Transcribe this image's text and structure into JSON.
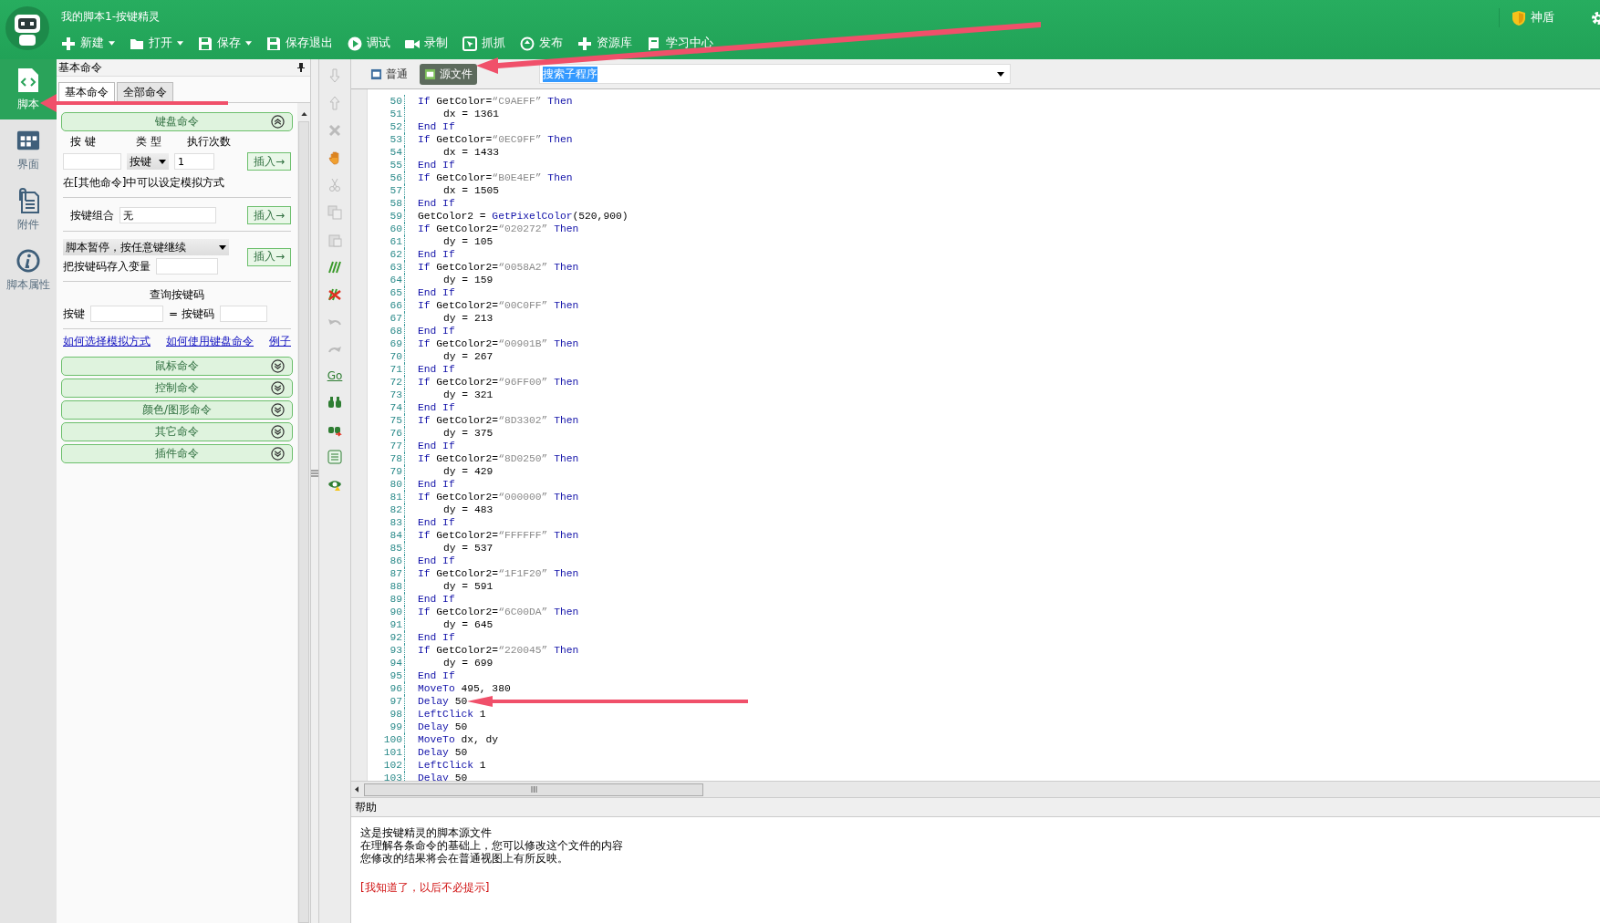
{
  "window": {
    "title": "我的脚本1-按键精灵"
  },
  "toolbar": [
    {
      "label": "新建",
      "dropdown": true
    },
    {
      "label": "打开",
      "dropdown": true
    },
    {
      "label": "保存",
      "dropdown": true
    },
    {
      "label": "保存退出",
      "dropdown": false
    },
    {
      "label": "调试",
      "dropdown": false
    },
    {
      "label": "录制",
      "dropdown": false
    },
    {
      "label": "抓抓",
      "dropdown": false
    },
    {
      "label": "发布",
      "dropdown": false
    },
    {
      "label": "资源库",
      "dropdown": false
    },
    {
      "label": "学习中心",
      "dropdown": false
    }
  ],
  "shield": {
    "label": "神盾"
  },
  "sidebar": [
    {
      "label": "脚本",
      "selected": true
    },
    {
      "label": "界面",
      "selected": false
    },
    {
      "label": "附件",
      "selected": false
    },
    {
      "label": "脚本属性",
      "selected": false
    }
  ],
  "command_panel": {
    "title": "基本命令",
    "tabs": [
      {
        "label": "基本命令",
        "selected": true
      },
      {
        "label": "全部命令",
        "selected": false
      }
    ],
    "keyboard": {
      "title": "键盘命令",
      "expanded": true,
      "key_label": "按 键",
      "type_label": "类 型",
      "count_label": "执行次数",
      "type_value": "按键",
      "count_value": "1",
      "note": "在[其他命令]中可以设定模拟方式",
      "combo_label": "按键组合",
      "combo_value": "无",
      "pause_value": "脚本暂停，按任意键继续",
      "store_label": "把按键码存入变量",
      "query_title": "查询按键码",
      "query_key_label": "按键",
      "query_code_label": "= 按键码",
      "inserts": [
        "插入→",
        "插入→",
        "插入→"
      ],
      "links": [
        "如何选择模拟方式",
        "如何使用键盘命令",
        "例子"
      ]
    },
    "sections": [
      {
        "title": "鼠标命令",
        "expanded": false
      },
      {
        "title": "控制命令",
        "expanded": false
      },
      {
        "title": "颜色/图形命令",
        "expanded": false
      },
      {
        "title": "其它命令",
        "expanded": false
      },
      {
        "title": "插件命令",
        "expanded": false
      }
    ]
  },
  "tool_strip": {
    "go_label": "Go"
  },
  "editor": {
    "tabs": [
      {
        "label": "普通",
        "selected": false
      },
      {
        "label": "源文件",
        "selected": true
      }
    ],
    "search": {
      "value": "搜索子程序"
    },
    "lines": [
      {
        "n": "50",
        "segs": [
          {
            "kind": "kw",
            "t": "If"
          },
          {
            "kind": "txt",
            "t": " GetColor="
          },
          {
            "kind": "str",
            "t": "“C9AEFF”"
          },
          {
            "kind": "kw",
            "t": " Then"
          }
        ],
        "children": [
          {
            "n": "51",
            "segs": [
              {
                "kind": "txt",
                "t": "dx = 1361"
              }
            ]
          }
        ]
      },
      {
        "n": "52",
        "segs": [
          {
            "kind": "kw",
            "t": "End If"
          }
        ]
      },
      {
        "n": "53",
        "segs": [
          {
            "kind": "kw",
            "t": "If"
          },
          {
            "kind": "txt",
            "t": " GetColor="
          },
          {
            "kind": "str",
            "t": "“0EC9FF”"
          },
          {
            "kind": "kw",
            "t": " Then"
          }
        ],
        "children": [
          {
            "n": "54",
            "segs": [
              {
                "kind": "txt",
                "t": "dx = 1433"
              }
            ]
          }
        ]
      },
      {
        "n": "55",
        "segs": [
          {
            "kind": "kw",
            "t": "End If"
          }
        ]
      },
      {
        "n": "56",
        "segs": [
          {
            "kind": "kw",
            "t": "If"
          },
          {
            "kind": "txt",
            "t": " GetColor="
          },
          {
            "kind": "str",
            "t": "“B0E4EF”"
          },
          {
            "kind": "kw",
            "t": " Then"
          }
        ],
        "children": [
          {
            "n": "57",
            "segs": [
              {
                "kind": "txt",
                "t": "dx = 1505"
              }
            ]
          }
        ]
      },
      {
        "n": "58",
        "segs": [
          {
            "kind": "kw",
            "t": "End If"
          }
        ]
      },
      {
        "n": "59",
        "segs": [
          {
            "kind": "txt",
            "t": "GetColor2 = "
          },
          {
            "kind": "kw",
            "t": "GetPixelColor"
          },
          {
            "kind": "txt",
            "t": "(520,900)"
          }
        ]
      },
      {
        "n": "60",
        "segs": [
          {
            "kind": "kw",
            "t": "If"
          },
          {
            "kind": "txt",
            "t": " GetColor2="
          },
          {
            "kind": "str",
            "t": "“020272”"
          },
          {
            "kind": "kw",
            "t": " Then"
          }
        ],
        "children": [
          {
            "n": "61",
            "segs": [
              {
                "kind": "txt",
                "t": "dy = 105"
              }
            ]
          }
        ]
      },
      {
        "n": "62",
        "segs": [
          {
            "kind": "kw",
            "t": "End If"
          }
        ]
      },
      {
        "n": "63",
        "segs": [
          {
            "kind": "kw",
            "t": "If"
          },
          {
            "kind": "txt",
            "t": " GetColor2="
          },
          {
            "kind": "str",
            "t": "“0058A2”"
          },
          {
            "kind": "kw",
            "t": " Then"
          }
        ],
        "children": [
          {
            "n": "64",
            "segs": [
              {
                "kind": "txt",
                "t": "dy = 159"
              }
            ]
          }
        ]
      },
      {
        "n": "65",
        "segs": [
          {
            "kind": "kw",
            "t": "End If"
          }
        ]
      },
      {
        "n": "66",
        "segs": [
          {
            "kind": "kw",
            "t": "If"
          },
          {
            "kind": "txt",
            "t": " GetColor2="
          },
          {
            "kind": "str",
            "t": "“00C0FF”"
          },
          {
            "kind": "kw",
            "t": " Then"
          }
        ],
        "children": [
          {
            "n": "67",
            "segs": [
              {
                "kind": "txt",
                "t": "dy = 213"
              }
            ]
          }
        ]
      },
      {
        "n": "68",
        "segs": [
          {
            "kind": "kw",
            "t": "End If"
          }
        ]
      },
      {
        "n": "69",
        "segs": [
          {
            "kind": "kw",
            "t": "If"
          },
          {
            "kind": "txt",
            "t": " GetColor2="
          },
          {
            "kind": "str",
            "t": "“00901B”"
          },
          {
            "kind": "kw",
            "t": " Then"
          }
        ],
        "children": [
          {
            "n": "70",
            "segs": [
              {
                "kind": "txt",
                "t": "dy = 267"
              }
            ]
          }
        ]
      },
      {
        "n": "71",
        "segs": [
          {
            "kind": "kw",
            "t": "End If"
          }
        ]
      },
      {
        "n": "72",
        "segs": [
          {
            "kind": "kw",
            "t": "If"
          },
          {
            "kind": "txt",
            "t": " GetColor2="
          },
          {
            "kind": "str",
            "t": "“96FF00”"
          },
          {
            "kind": "kw",
            "t": " Then"
          }
        ],
        "children": [
          {
            "n": "73",
            "segs": [
              {
                "kind": "txt",
                "t": "dy = 321"
              }
            ]
          }
        ]
      },
      {
        "n": "74",
        "segs": [
          {
            "kind": "kw",
            "t": "End If"
          }
        ]
      },
      {
        "n": "75",
        "segs": [
          {
            "kind": "kw",
            "t": "If"
          },
          {
            "kind": "txt",
            "t": " GetColor2="
          },
          {
            "kind": "str",
            "t": "“8D3302”"
          },
          {
            "kind": "kw",
            "t": " Then"
          }
        ],
        "children": [
          {
            "n": "76",
            "segs": [
              {
                "kind": "txt",
                "t": "dy = 375"
              }
            ]
          }
        ]
      },
      {
        "n": "77",
        "segs": [
          {
            "kind": "kw",
            "t": "End If"
          }
        ]
      },
      {
        "n": "78",
        "segs": [
          {
            "kind": "kw",
            "t": "If"
          },
          {
            "kind": "txt",
            "t": " GetColor2="
          },
          {
            "kind": "str",
            "t": "“8D0250”"
          },
          {
            "kind": "kw",
            "t": " Then"
          }
        ],
        "children": [
          {
            "n": "79",
            "segs": [
              {
                "kind": "txt",
                "t": "dy = 429"
              }
            ]
          }
        ]
      },
      {
        "n": "80",
        "segs": [
          {
            "kind": "kw",
            "t": "End If"
          }
        ]
      },
      {
        "n": "81",
        "segs": [
          {
            "kind": "kw",
            "t": "If"
          },
          {
            "kind": "txt",
            "t": " GetColor2="
          },
          {
            "kind": "str",
            "t": "“000000”"
          },
          {
            "kind": "kw",
            "t": " Then"
          }
        ],
        "children": [
          {
            "n": "82",
            "segs": [
              {
                "kind": "txt",
                "t": "dy = 483"
              }
            ]
          }
        ]
      },
      {
        "n": "83",
        "segs": [
          {
            "kind": "kw",
            "t": "End If"
          }
        ]
      },
      {
        "n": "84",
        "segs": [
          {
            "kind": "kw",
            "t": "If"
          },
          {
            "kind": "txt",
            "t": " GetColor2="
          },
          {
            "kind": "str",
            "t": "“FFFFFF”"
          },
          {
            "kind": "kw",
            "t": " Then"
          }
        ],
        "children": [
          {
            "n": "85",
            "segs": [
              {
                "kind": "txt",
                "t": "dy = 537"
              }
            ]
          }
        ]
      },
      {
        "n": "86",
        "segs": [
          {
            "kind": "kw",
            "t": "End If"
          }
        ]
      },
      {
        "n": "87",
        "segs": [
          {
            "kind": "kw",
            "t": "If"
          },
          {
            "kind": "txt",
            "t": " GetColor2="
          },
          {
            "kind": "str",
            "t": "“1F1F20”"
          },
          {
            "kind": "kw",
            "t": " Then"
          }
        ],
        "children": [
          {
            "n": "88",
            "segs": [
              {
                "kind": "txt",
                "t": "dy = 591"
              }
            ]
          }
        ]
      },
      {
        "n": "89",
        "segs": [
          {
            "kind": "kw",
            "t": "End If"
          }
        ]
      },
      {
        "n": "90",
        "segs": [
          {
            "kind": "kw",
            "t": "If"
          },
          {
            "kind": "txt",
            "t": " GetColor2="
          },
          {
            "kind": "str",
            "t": "“6C00DA”"
          },
          {
            "kind": "kw",
            "t": " Then"
          }
        ],
        "children": [
          {
            "n": "91",
            "segs": [
              {
                "kind": "txt",
                "t": "dy = 645"
              }
            ]
          }
        ]
      },
      {
        "n": "92",
        "segs": [
          {
            "kind": "kw",
            "t": "End If"
          }
        ]
      },
      {
        "n": "93",
        "segs": [
          {
            "kind": "kw",
            "t": "If"
          },
          {
            "kind": "txt",
            "t": " GetColor2="
          },
          {
            "kind": "str",
            "t": "“220045”"
          },
          {
            "kind": "kw",
            "t": " Then"
          }
        ],
        "children": [
          {
            "n": "94",
            "segs": [
              {
                "kind": "txt",
                "t": "dy = 699"
              }
            ]
          }
        ]
      },
      {
        "n": "95",
        "segs": [
          {
            "kind": "kw",
            "t": "End If"
          }
        ]
      },
      {
        "n": "96",
        "segs": [
          {
            "kind": "kw",
            "t": "MoveTo"
          },
          {
            "kind": "txt",
            "t": " 495, 380"
          }
        ]
      },
      {
        "n": "97",
        "segs": [
          {
            "kind": "kw",
            "t": "Delay"
          },
          {
            "kind": "txt",
            "t": " 50"
          }
        ]
      },
      {
        "n": "98",
        "segs": [
          {
            "kind": "kw",
            "t": "LeftClick"
          },
          {
            "kind": "txt",
            "t": " 1"
          }
        ]
      },
      {
        "n": "99",
        "segs": [
          {
            "kind": "kw",
            "t": "Delay"
          },
          {
            "kind": "txt",
            "t": " 50"
          }
        ]
      },
      {
        "n": "100",
        "segs": [
          {
            "kind": "kw",
            "t": "MoveTo"
          },
          {
            "kind": "txt",
            "t": " dx, dy"
          }
        ]
      },
      {
        "n": "101",
        "segs": [
          {
            "kind": "kw",
            "t": "Delay"
          },
          {
            "kind": "txt",
            "t": " 50"
          }
        ]
      },
      {
        "n": "102",
        "segs": [
          {
            "kind": "kw",
            "t": "LeftClick"
          },
          {
            "kind": "txt",
            "t": " 1"
          }
        ]
      },
      {
        "n": "103",
        "segs": [
          {
            "kind": "kw",
            "t": "Delay"
          },
          {
            "kind": "txt",
            "t": " 50"
          }
        ]
      }
    ]
  },
  "help": {
    "title": "帮助",
    "lines": [
      "这是按键精灵的脚本源文件",
      "在理解各条命令的基础上，您可以修改这个文件的内容",
      "您修改的结果将会在普通视图上有所反映。"
    ],
    "dismiss": "[我知道了，以后不必提示]"
  }
}
